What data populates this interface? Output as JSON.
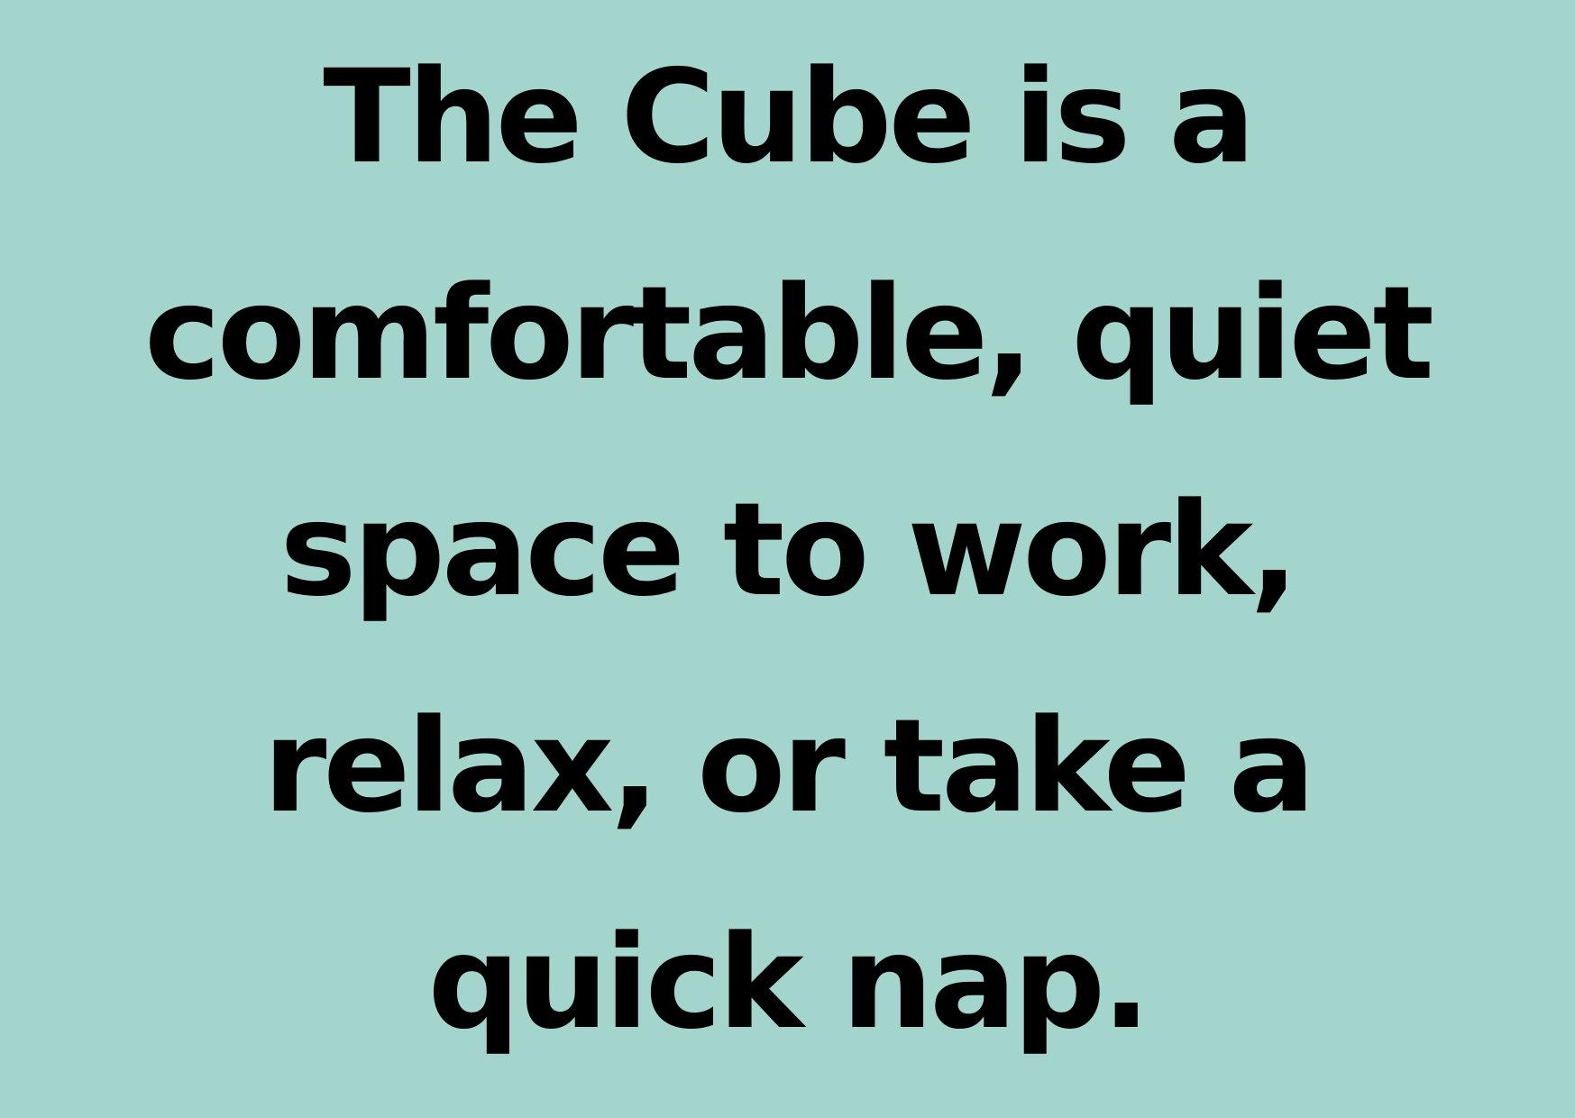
{
  "background_color": "#a3d5cd",
  "text_color": "#000000",
  "quote": {
    "lines": [
      "The Cube is a",
      "comfortable, quiet",
      "space to work,",
      "relax, or take a",
      "quick nap."
    ]
  }
}
